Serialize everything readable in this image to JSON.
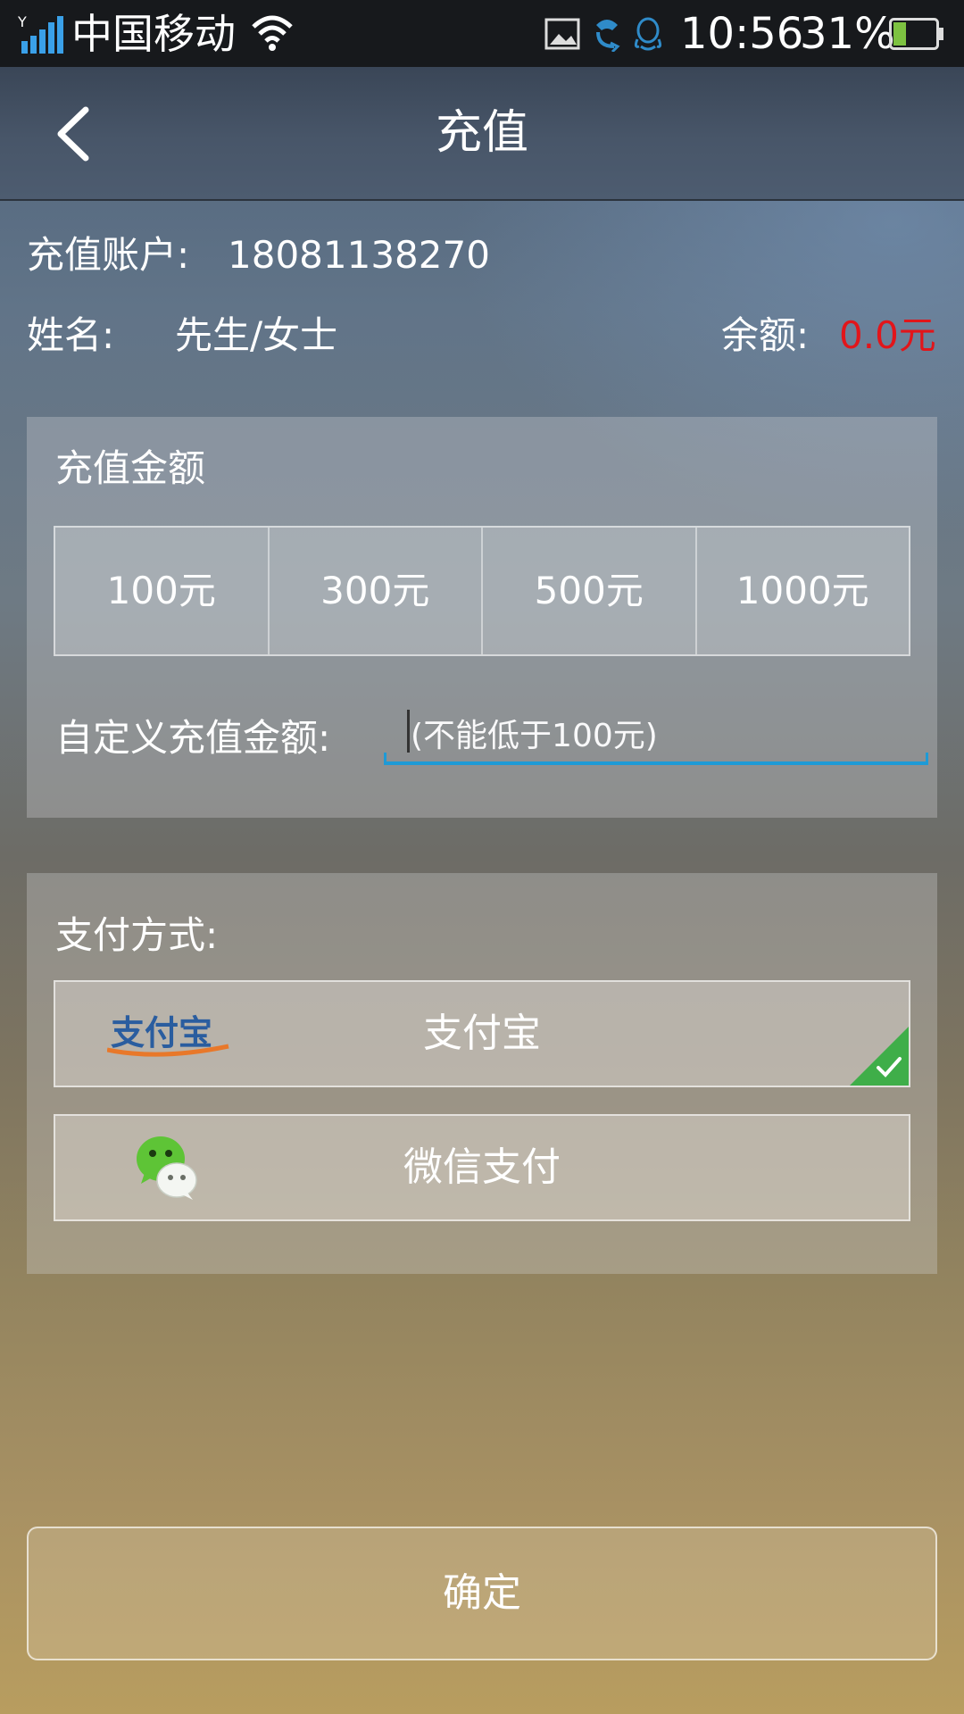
{
  "status_bar": {
    "carrier": "中国移动",
    "time": "10:56",
    "battery": "31%",
    "battery_level": 0.31,
    "icons": [
      "signal-icon",
      "wifi-icon",
      "image-icon",
      "phone-icon",
      "qq-icon",
      "battery-icon"
    ]
  },
  "header": {
    "title": "充值",
    "back_icon": "chevron-left-icon"
  },
  "account": {
    "label": "充值账户:",
    "value": "18081138270"
  },
  "name": {
    "label": "姓名:",
    "value": "先生/女士"
  },
  "balance": {
    "label": "余额:",
    "value": "0.0元"
  },
  "amount_panel": {
    "title": "充值金额",
    "options": [
      "100元",
      "300元",
      "500元",
      "1000元"
    ],
    "custom_label": "自定义充值金额:",
    "custom_placeholder": "(不能低于100元)",
    "custom_value": ""
  },
  "payment_panel": {
    "title": "支付方式:",
    "methods": [
      {
        "label": "支付宝",
        "logo_text": "支付宝",
        "icon": "alipay-logo",
        "selected": true
      },
      {
        "label": "微信支付",
        "icon": "wechat-icon",
        "selected": false
      }
    ]
  },
  "confirm": {
    "label": "确定"
  },
  "colors": {
    "balance_red": "#e2151a",
    "input_underline": "#1e9ad6",
    "check_green": "#3fae49"
  }
}
